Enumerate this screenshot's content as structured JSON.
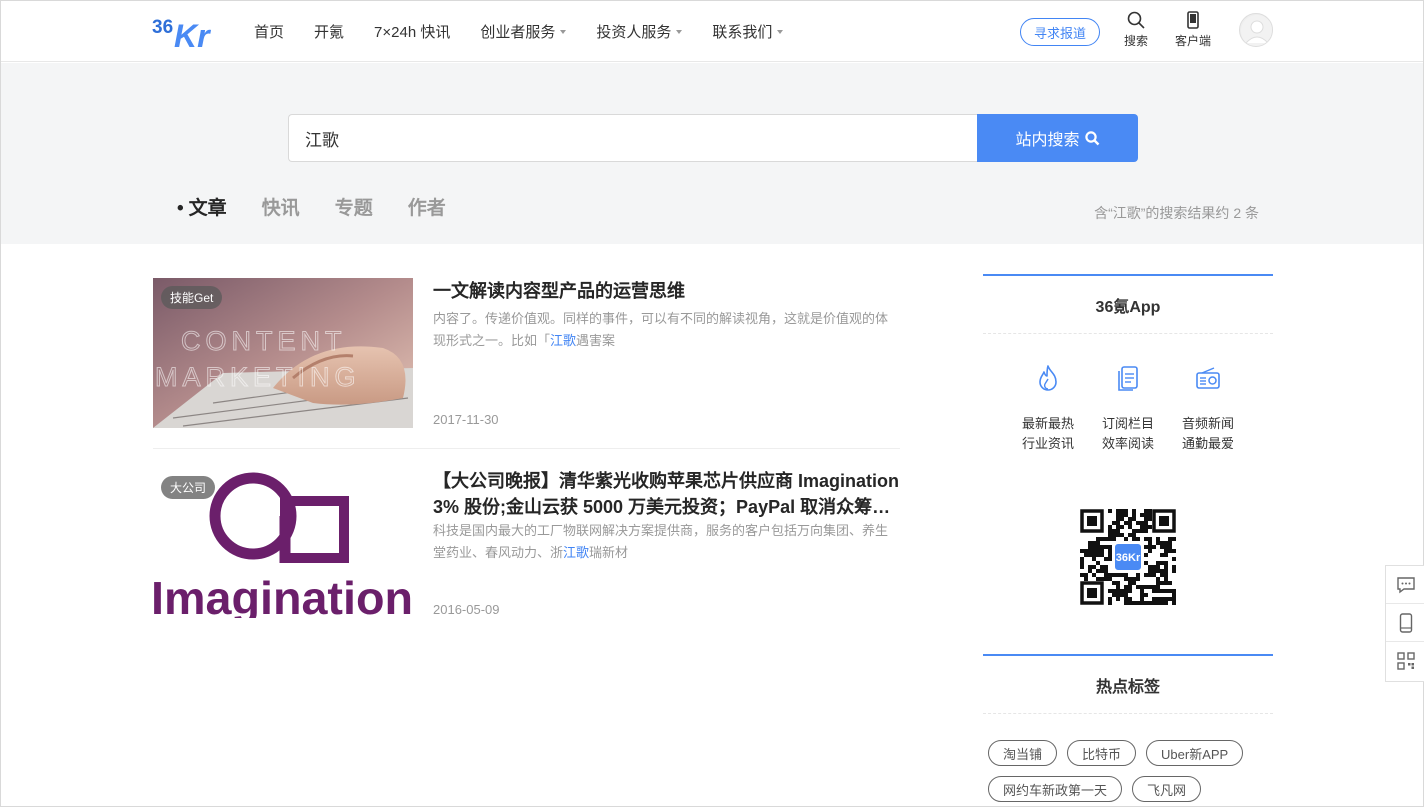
{
  "header": {
    "logo_text": "36Kr",
    "nav": [
      {
        "label": "首页",
        "dropdown": false
      },
      {
        "label": "开氪",
        "dropdown": false
      },
      {
        "label": "7×24h 快讯",
        "dropdown": false
      },
      {
        "label": "创业者服务",
        "dropdown": true
      },
      {
        "label": "投资人服务",
        "dropdown": true
      },
      {
        "label": "联系我们",
        "dropdown": true
      }
    ],
    "report_button": "寻求报道",
    "search_label": "搜索",
    "client_label": "客户端"
  },
  "search": {
    "query": "江歌",
    "button_label": "站内搜索",
    "tabs": [
      "文章",
      "快讯",
      "专题",
      "作者"
    ],
    "active_tab": "文章",
    "result_summary": "含“江歌”的搜索结果约  2  条"
  },
  "articles": [
    {
      "badge": "技能Get",
      "title": "一文解读内容型产品的运营思维",
      "summary_before": "内容了。传递价值观。同样的事件，可以有不同的解读视角，这就是价值观的体现形式之一。比如「",
      "summary_highlight": "江歌",
      "summary_after": "遇害案",
      "date": "2017-11-30",
      "image_text": [
        "CONTENT",
        "MARKETING"
      ]
    },
    {
      "badge": "大公司",
      "title": "【大公司晚报】清华紫光收购苹果芯片供应商 Imagination 3% 股份;金山云获 5000 万美元投资；PayPal 取消众筹服务",
      "summary_before": "科技是国内最大的工厂物联网解决方案提供商，服务的客户包括万向集团、养生堂药业、春风动力、浙",
      "summary_highlight": "江歌",
      "summary_after": "瑞新材",
      "date": "2016-05-09",
      "image_text": [
        "Imagination"
      ]
    }
  ],
  "sidebar": {
    "app": {
      "title": "36氪App",
      "features": [
        {
          "icon": "flame-icon",
          "line1": "最新最热",
          "line2": "行业资讯"
        },
        {
          "icon": "document-icon",
          "line1": "订阅栏目",
          "line2": "效率阅读"
        },
        {
          "icon": "radio-icon",
          "line1": "音频新闻",
          "line2": "通勤最爱"
        }
      ],
      "qr_logo": "36Kr"
    },
    "hot_tags": {
      "title": "热点标签",
      "tags": [
        "淘当铺",
        "比特币",
        "Uber新APP",
        "网约车新政第一天",
        "飞凡网"
      ]
    }
  },
  "colors": {
    "accent": "#4a8af4",
    "band_bg": "#f4f5f6"
  }
}
